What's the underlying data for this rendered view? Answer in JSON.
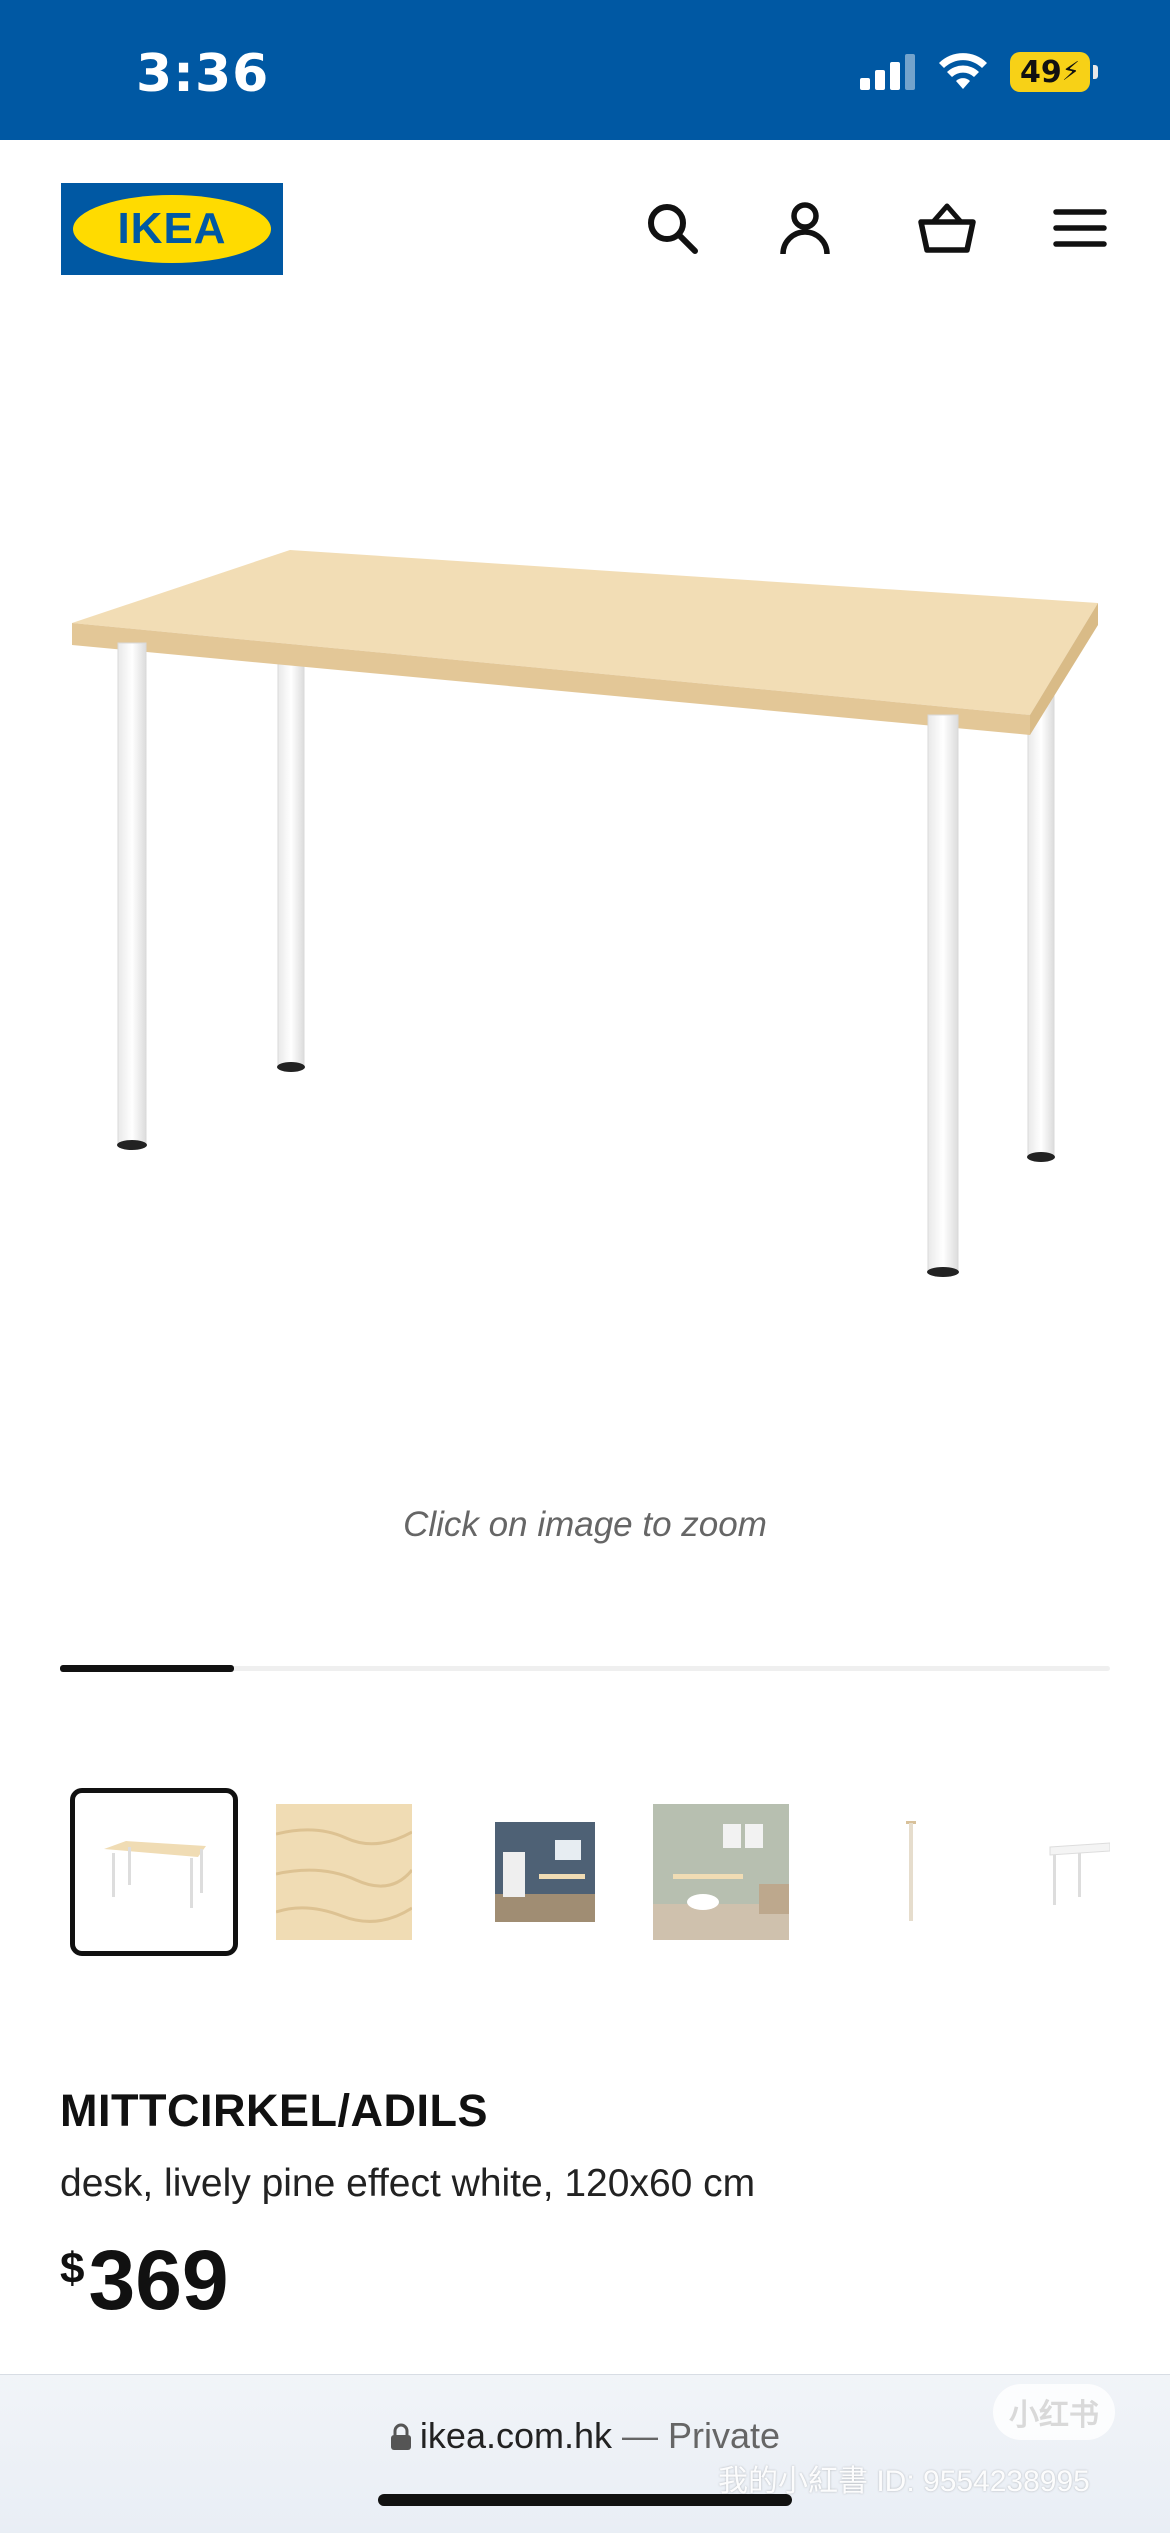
{
  "status_bar": {
    "time": "3:36",
    "battery": "49"
  },
  "header": {
    "logo_text": "IKEA"
  },
  "gallery": {
    "zoom_hint": "Click on image to zoom",
    "progress": 0.166
  },
  "product": {
    "name": "MITTCIRKEL/ADILS",
    "description": "desk, lively pine effect white, 120x60 cm",
    "currency": "$",
    "price": "369"
  },
  "browser": {
    "url": "ikea.com.hk",
    "privacy": "— Private"
  },
  "watermark": {
    "text": "我的小紅書 ID: 9554238995",
    "badge": "小红书"
  },
  "colors": {
    "ikea_blue": "#0058a3",
    "ikea_yellow": "#ffdb00",
    "pine": "#f0dcb4"
  }
}
